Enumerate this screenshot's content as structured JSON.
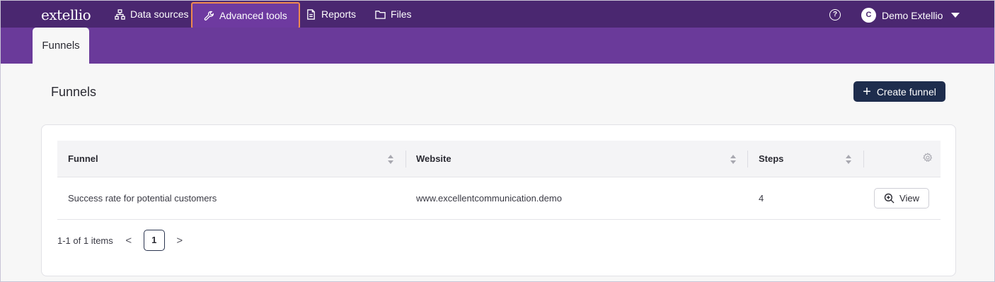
{
  "app": {
    "logo": "extellio"
  },
  "nav": {
    "items": [
      {
        "label": "Data sources",
        "icon": "sitemap-icon"
      },
      {
        "label": "Advanced tools",
        "icon": "wrench-icon",
        "active": true
      },
      {
        "label": "Reports",
        "icon": "document-icon"
      },
      {
        "label": "Files",
        "icon": "folder-icon"
      }
    ],
    "help_symbol": "?",
    "user": {
      "initial": "C",
      "name": "Demo Extellio"
    }
  },
  "subnav": {
    "tab": "Funnels"
  },
  "page": {
    "title": "Funnels",
    "create_label": "Create funnel",
    "create_symbol": "+"
  },
  "table": {
    "columns": [
      "Funnel",
      "Website",
      "Steps"
    ],
    "rows": [
      {
        "funnel": "Success rate for potential customers",
        "website": "www.excellentcommunication.demo",
        "steps": "4",
        "action": "View"
      }
    ]
  },
  "pagination": {
    "summary": "1-1 of 1 items",
    "current_page": "1",
    "prev_symbol": "<",
    "next_symbol": ">"
  },
  "colors": {
    "topbar": "#4a2770",
    "subbar": "#6a3a9a",
    "active_nav": "#6e3aa0",
    "highlight_border": "#f08a4f",
    "primary_button": "#1e2d4d"
  }
}
